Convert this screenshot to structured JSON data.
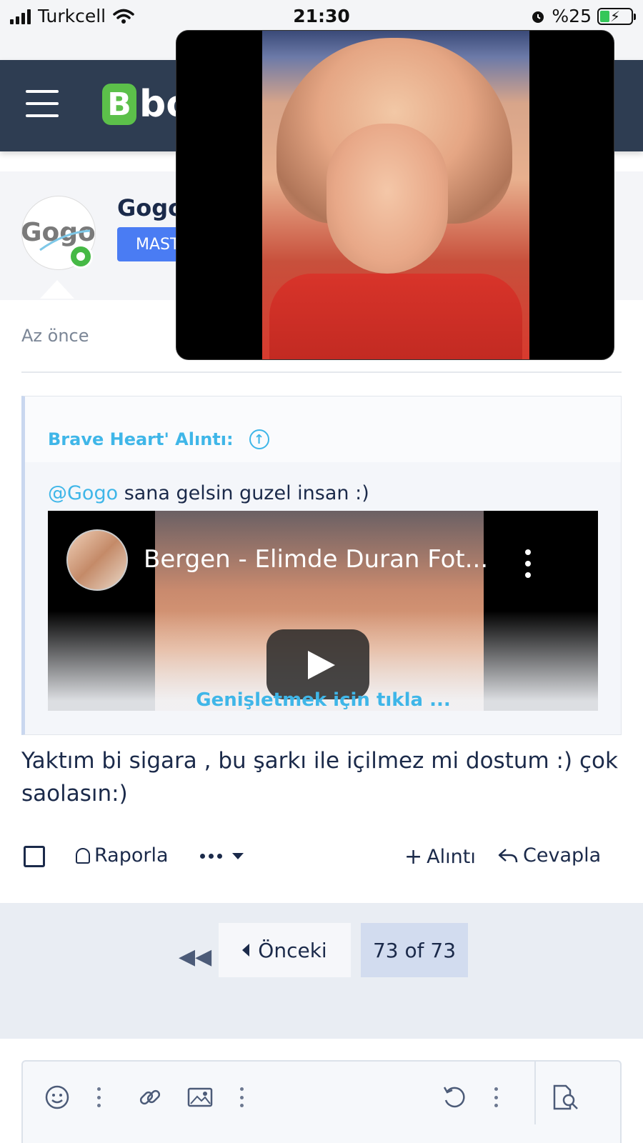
{
  "status_bar": {
    "carrier": "Turkcell",
    "time": "21:30",
    "battery_text": "%25"
  },
  "header": {
    "logo_mark": "B",
    "logo_text": "bo"
  },
  "user": {
    "name": "Gogo",
    "avatar_text": "Gogo",
    "rank": "MAST"
  },
  "post": {
    "time": "Az önce",
    "quote": {
      "author_label": "Brave Heart' Alıntı:",
      "mention": "@Gogo",
      "text": " sana gelsin guzel insan :)",
      "video_title": "Bergen - Elimde Duran Fot...",
      "expand_label": "Genişletmek için tıkla ..."
    },
    "message": "Yaktım bi sigara , bu şarkı ile içilmez mi dostum :) çok saolasın:)"
  },
  "actions": {
    "report": "Raporla",
    "quote": "Alıntı",
    "reply": "Cevapla"
  },
  "pagination": {
    "first": "◀◀",
    "prev": "Önceki",
    "current": "73 of 73"
  },
  "editor": {
    "icons": [
      "smile-icon",
      "link-icon",
      "image-icon",
      "undo-icon",
      "preview-icon"
    ]
  },
  "colors": {
    "header_bg": "#2e3d52",
    "accent_blue": "#3fb6e8",
    "rank_blue": "#4a7cf3",
    "logo_green": "#5cc04a"
  }
}
